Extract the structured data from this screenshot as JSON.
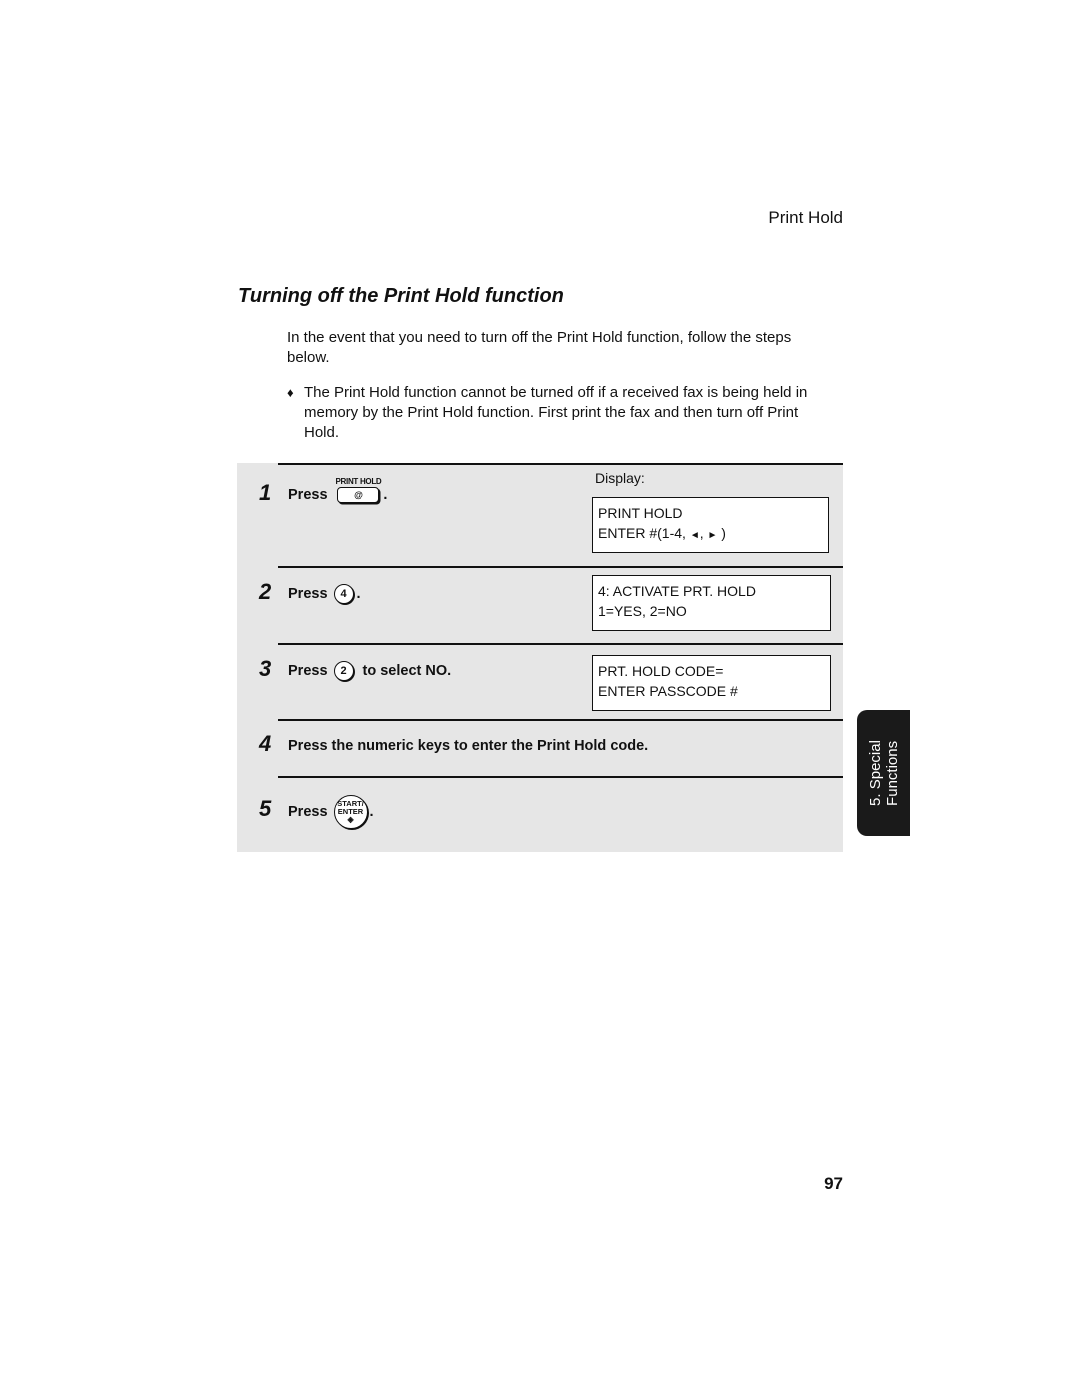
{
  "running_head": "Print Hold",
  "section_title": "Turning off the Print Hold function",
  "intro": "In the event that you need to turn off the Print Hold function, follow the steps below.",
  "note": {
    "bullet": "♦",
    "text": "The Print Hold function cannot be turned off if a received fax is being held in memory by the Print Hold function. First print the fax and then turn off Print Hold."
  },
  "display_label": "Display:",
  "steps": [
    {
      "number": "1",
      "press": "Press",
      "key_label": "PRINT HOLD",
      "key_symbol": "@",
      "suffix": ".",
      "display": [
        "PRINT HOLD",
        "ENTER #(1-4,",
        "◄",
        ",",
        "►",
        ")"
      ]
    },
    {
      "number": "2",
      "press": "Press",
      "key": "4",
      "suffix": ".",
      "display": [
        "4: ACTIVATE PRT. HOLD",
        "1=YES, 2=NO"
      ]
    },
    {
      "number": "3",
      "press": "Press",
      "key": "2",
      "suffix": "to select NO.",
      "display": [
        "PRT. HOLD CODE=",
        "ENTER PASSCODE #"
      ]
    },
    {
      "number": "4",
      "text": "Press the numeric keys to enter the Print Hold code."
    },
    {
      "number": "5",
      "press": "Press",
      "key_line1": "START/",
      "key_line2": "ENTER",
      "key_symbol": "◈",
      "suffix": "."
    }
  ],
  "side_tab": {
    "line1": "5. Special",
    "line2": "Functions"
  },
  "page_number": "97"
}
